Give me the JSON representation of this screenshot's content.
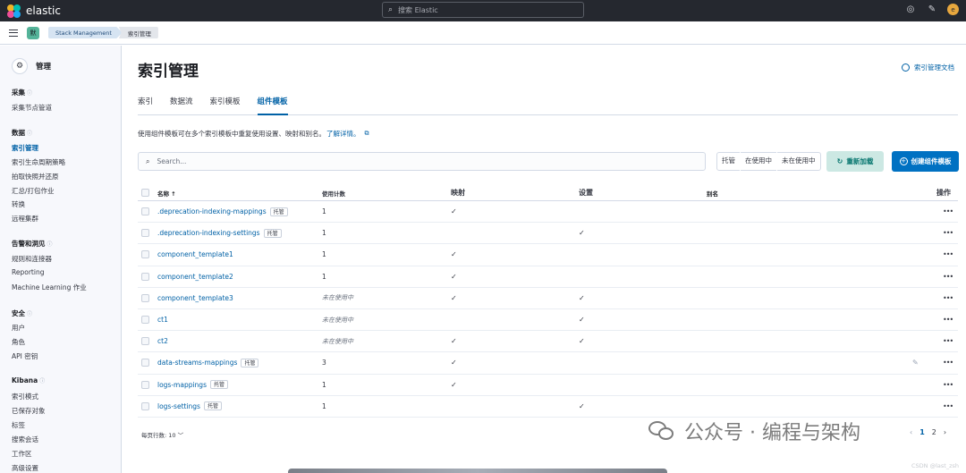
{
  "app": {
    "brand": "elastic",
    "search_placeholder": "搜索 Elastic",
    "avatar_letter": "e",
    "space_letter": "默"
  },
  "breadcrumb": [
    "Stack Management",
    "索引管理"
  ],
  "sidebar": {
    "title": "管理",
    "sections": [
      {
        "label": "采集",
        "items": [
          "采集节点管道"
        ]
      },
      {
        "label": "数据",
        "items": [
          "索引管理",
          "索引生命周期策略",
          "拍取快照并还原",
          "汇总/打包作业",
          "转换",
          "远程集群"
        ]
      },
      {
        "label": "告警和洞见",
        "items": [
          "规则和连接器",
          "Reporting",
          "Machine Learning 作业"
        ]
      },
      {
        "label": "安全",
        "items": [
          "用户",
          "角色",
          "API 密钥"
        ]
      },
      {
        "label": "Kibana",
        "items": [
          "索引模式",
          "已保存对象",
          "标签",
          "搜索会话",
          "工作区",
          "高级设置"
        ]
      }
    ],
    "active_item": "索引管理"
  },
  "page": {
    "title": "索引管理",
    "doc_link": "索引管理文档",
    "tabs": [
      "索引",
      "数据流",
      "索引模板",
      "组件模板"
    ],
    "active_tab": "组件模板",
    "description": "使用组件模板可在多个索引模板中重复使用设置、映射和别名。",
    "learn_more": "了解详情。",
    "search_placeholder": "Search...",
    "filters": [
      "托管",
      "在使用中",
      "未在使用中"
    ],
    "reload_button": "重新加载",
    "create_button": "创建组件模板"
  },
  "table": {
    "headers": {
      "name": "名称 ↑",
      "usage": "使用计数",
      "mappings": "映射",
      "settings": "设置",
      "aliases": "别名",
      "actions": "操作"
    },
    "rows": [
      {
        "name": ".deprecation-indexing-mappings",
        "managed": "托管",
        "usage": "1",
        "mappings": "✓",
        "settings": "",
        "unused": false
      },
      {
        "name": ".deprecation-indexing-settings",
        "managed": "托管",
        "usage": "1",
        "mappings": "",
        "settings": "✓",
        "unused": false
      },
      {
        "name": "component_template1",
        "managed": "",
        "usage": "1",
        "mappings": "✓",
        "settings": "",
        "unused": false
      },
      {
        "name": "component_template2",
        "managed": "",
        "usage": "1",
        "mappings": "✓",
        "settings": "",
        "unused": false
      },
      {
        "name": "component_template3",
        "managed": "",
        "usage": "未在使用中",
        "mappings": "✓",
        "settings": "✓",
        "unused": true
      },
      {
        "name": "ct1",
        "managed": "",
        "usage": "未在使用中",
        "mappings": "",
        "settings": "✓",
        "unused": true
      },
      {
        "name": "ct2",
        "managed": "",
        "usage": "未在使用中",
        "mappings": "✓",
        "settings": "✓",
        "unused": true
      },
      {
        "name": "data-streams-mappings",
        "managed": "托管",
        "usage": "3",
        "mappings": "✓",
        "settings": "",
        "unused": false
      },
      {
        "name": "logs-mappings",
        "managed": "托管",
        "usage": "1",
        "mappings": "✓",
        "settings": "",
        "unused": false
      },
      {
        "name": "logs-settings",
        "managed": "托管",
        "usage": "1",
        "mappings": "",
        "settings": "✓",
        "unused": false
      }
    ],
    "row_action": "•••"
  },
  "pagination": {
    "rows_per_page": "每页行数: 10 ﹀",
    "pages": [
      "1",
      "2"
    ],
    "current": "1"
  },
  "watermark": {
    "text": "公众号 · 编程与架构",
    "csdn": "CSDN @last_zsh"
  }
}
